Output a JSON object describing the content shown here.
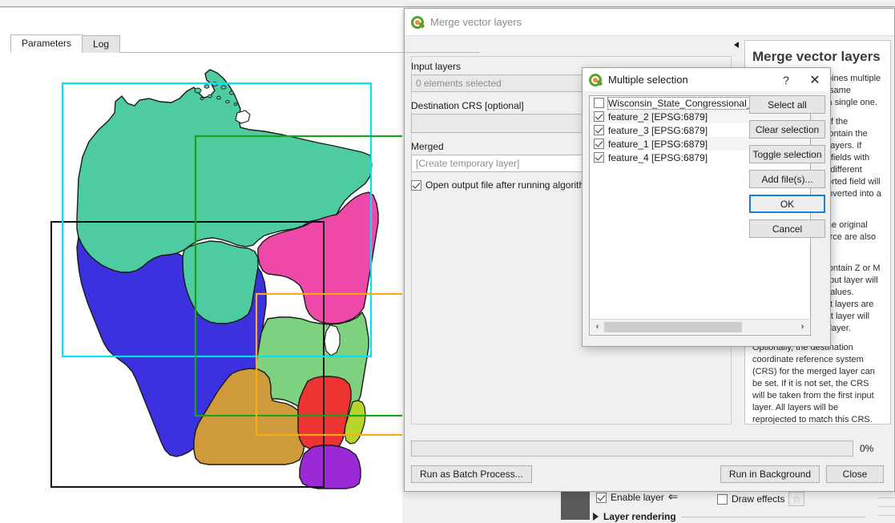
{
  "map": {
    "name": "wisconsin-congressional-districts",
    "districts": [
      {
        "id": "d7",
        "color": "#4ecba0"
      },
      {
        "id": "d3",
        "color": "#3b31de"
      },
      {
        "id": "d8",
        "color": "#ee49a9"
      },
      {
        "id": "d6",
        "color": "#7ed17e"
      },
      {
        "id": "d2",
        "color": "#cf9a3b"
      },
      {
        "id": "d5",
        "color": "#ee3333"
      },
      {
        "id": "d4",
        "color": "#9b2ad6"
      },
      {
        "id": "d1",
        "color": "#b5d62a"
      }
    ],
    "extent_rectangles": [
      {
        "id": "feature_1",
        "color": "#00e5f5"
      },
      {
        "id": "feature_2",
        "color": "#19a319"
      },
      {
        "id": "feature_3",
        "color": "#111111"
      },
      {
        "id": "feature_4",
        "color": "#ffaa11"
      }
    ],
    "outline_color": "#1a1a1a"
  },
  "merge_dialog": {
    "title": "Merge vector layers",
    "icon": "qgis-logo-icon",
    "tabs": [
      {
        "id": "parameters",
        "label": "Parameters",
        "active": true
      },
      {
        "id": "log",
        "label": "Log",
        "active": false
      }
    ],
    "fields": {
      "input_layers_label": "Input layers",
      "input_layers_value": "0 elements selected",
      "destination_crs_label": "Destination CRS [optional]",
      "destination_crs_value": "",
      "merged_label": "Merged",
      "merged_value": "[Create temporary layer]",
      "open_output_label": "Open output file after running algorithm",
      "open_output_checked": true
    },
    "progress": {
      "percent_label": "0%",
      "value": 0
    },
    "buttons": {
      "batch": "Run as Batch Process...",
      "run_background": "Run in Background",
      "close": "Close"
    },
    "collapse_arrow": "collapse-panel-arrow-icon"
  },
  "help_panel": {
    "title": "Merge vector layers",
    "paragraphs": [
      "This algorithm combines multiple vector layers of the same geometry type into a single one.",
      "The attribute table of the resulting layer will contain the fields from all input layers. If input layers contain fields with the same name but different types, then the exported field will be automatically converted into a string type field.",
      "New fields storing the original layer name and source are also added.",
      "If any input layers contain Z or M values, then the output layer will also contain these values. Similarly, if any input layers are multi-part, the output layer will also be a multi-part layer.",
      "Optionally, the destination coordinate reference system (CRS) for the merged layer can be set. If it is not set, the CRS will be taken from the first input layer. All layers will be reprojected to match this CRS."
    ]
  },
  "multiple_selection_dialog": {
    "title": "Multiple selection",
    "icon": "qgis-logo-icon",
    "help_button": "?",
    "close_button": "✕",
    "items": [
      {
        "label": "Wisconsin_State_Congressional_Districts [EPSG",
        "checked": false,
        "focused": true
      },
      {
        "label": "feature_2 [EPSG:6879]",
        "checked": true,
        "focused": false
      },
      {
        "label": "feature_3 [EPSG:6879]",
        "checked": true,
        "focused": false
      },
      {
        "label": "feature_1 [EPSG:6879]",
        "checked": true,
        "focused": false
      },
      {
        "label": "feature_4 [EPSG:6879]",
        "checked": true,
        "focused": false
      }
    ],
    "buttons": [
      {
        "id": "select-all",
        "label": "Select all",
        "focused": false
      },
      {
        "id": "clear-selection",
        "label": "Clear selection",
        "focused": false
      },
      {
        "id": "toggle-selection",
        "label": "Toggle selection",
        "focused": false
      },
      {
        "id": "add-files",
        "label": "Add file(s)...",
        "focused": false
      },
      {
        "id": "ok",
        "label": "OK",
        "focused": true
      },
      {
        "id": "cancel",
        "label": "Cancel",
        "focused": false
      }
    ],
    "scroll": {
      "left_arrow": "‹",
      "right_arrow": "›"
    }
  },
  "layer_properties_strip": {
    "enable_layer_label": "Enable layer",
    "enable_layer_checked": true,
    "draw_effects_label": "Draw effects",
    "draw_effects_checked": false,
    "layer_rendering_label": "Layer rendering",
    "blend_icon": "blend-mode-icon",
    "effects_icon": "star-effects-icon"
  }
}
